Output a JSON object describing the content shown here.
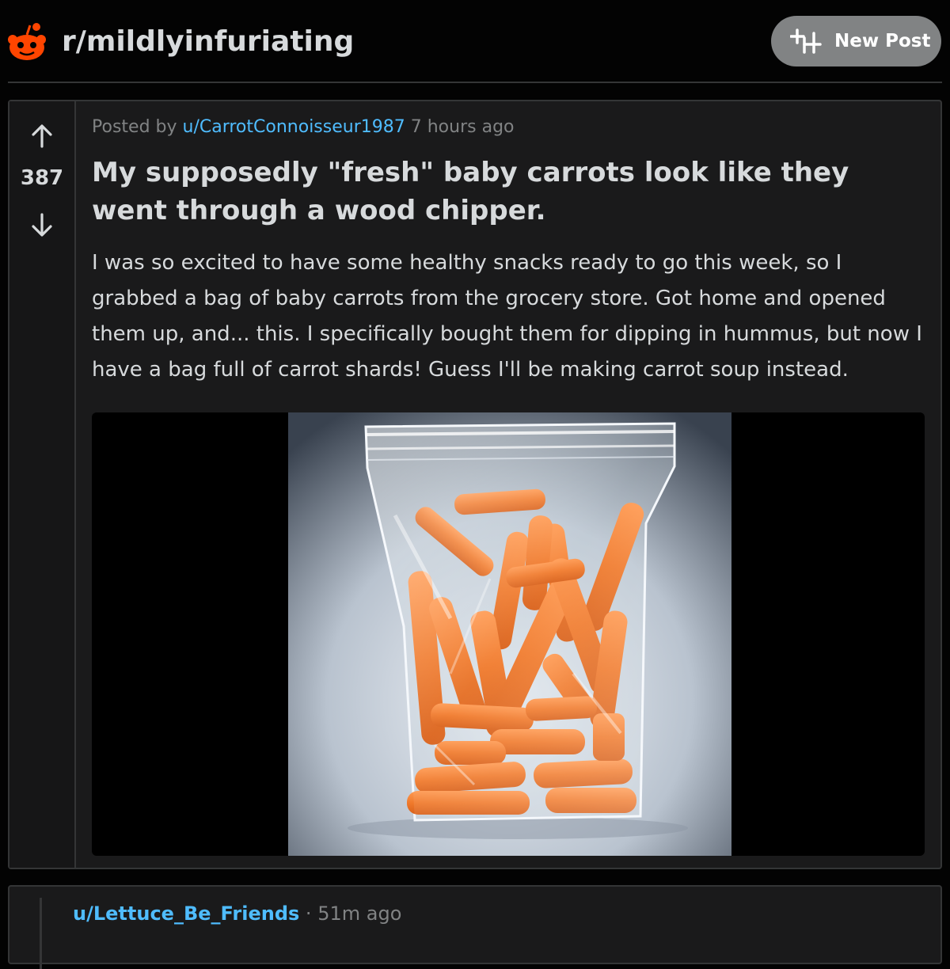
{
  "header": {
    "subreddit": "r/mildlyinfuriating",
    "new_post_label": "New Post",
    "logo_icon": "reddit-alien-icon",
    "new_post_icon": "new-post-icon"
  },
  "post": {
    "posted_by_prefix": "Posted by",
    "author": "u/CarrotConnoisseur1987",
    "time": "7 hours ago",
    "score": "387",
    "title": "My supposedly \"fresh\" baby carrots look like they went through a wood chipper.",
    "body": "I was so excited to have some healthy snacks ready to go this week, so I grabbed a bag of baby carrots from the grocery store. Got home and opened them up, and... this. I specifically bought them for dipping in hummus, but now I have a bag full of carrot shards! Guess I'll be making carrot soup instead.",
    "upvote_icon": "arrow-up-icon",
    "downvote_icon": "arrow-down-icon"
  },
  "comment": {
    "author": "u/Lettuce_Be_Friends",
    "separator": "·",
    "time": "51m ago"
  },
  "colors": {
    "background": "#030303",
    "card": "#1a1a1b",
    "border": "#343536",
    "text": "#d7dadc",
    "muted": "#818384",
    "link": "#4fbcff",
    "reddit_orange": "#ff4500",
    "button": "#818384"
  }
}
